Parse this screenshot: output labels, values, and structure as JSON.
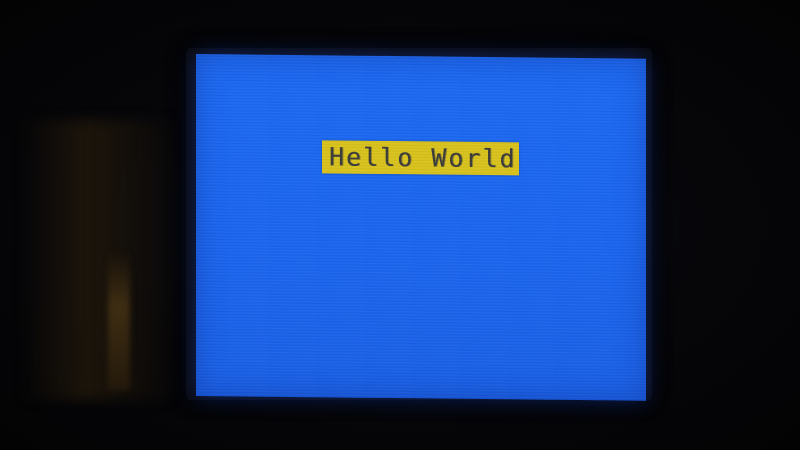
{
  "display": {
    "background_color": "#1b66f0",
    "label": {
      "text": "Hello World",
      "background_color": "#d8c21d",
      "text_color": "#3a3a38"
    }
  }
}
